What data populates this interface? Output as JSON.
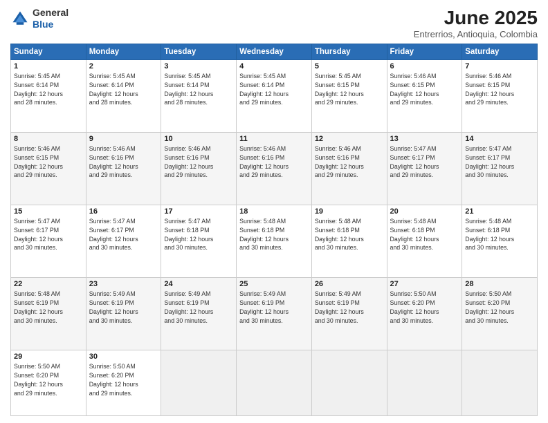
{
  "header": {
    "logo_general": "General",
    "logo_blue": "Blue",
    "month_year": "June 2025",
    "location": "Entrerrios, Antioquia, Colombia"
  },
  "weekdays": [
    "Sunday",
    "Monday",
    "Tuesday",
    "Wednesday",
    "Thursday",
    "Friday",
    "Saturday"
  ],
  "weeks": [
    [
      {
        "day": "1",
        "lines": [
          "Sunrise: 5:45 AM",
          "Sunset: 6:14 PM",
          "Daylight: 12 hours",
          "and 28 minutes."
        ]
      },
      {
        "day": "2",
        "lines": [
          "Sunrise: 5:45 AM",
          "Sunset: 6:14 PM",
          "Daylight: 12 hours",
          "and 28 minutes."
        ]
      },
      {
        "day": "3",
        "lines": [
          "Sunrise: 5:45 AM",
          "Sunset: 6:14 PM",
          "Daylight: 12 hours",
          "and 28 minutes."
        ]
      },
      {
        "day": "4",
        "lines": [
          "Sunrise: 5:45 AM",
          "Sunset: 6:14 PM",
          "Daylight: 12 hours",
          "and 29 minutes."
        ]
      },
      {
        "day": "5",
        "lines": [
          "Sunrise: 5:45 AM",
          "Sunset: 6:15 PM",
          "Daylight: 12 hours",
          "and 29 minutes."
        ]
      },
      {
        "day": "6",
        "lines": [
          "Sunrise: 5:46 AM",
          "Sunset: 6:15 PM",
          "Daylight: 12 hours",
          "and 29 minutes."
        ]
      },
      {
        "day": "7",
        "lines": [
          "Sunrise: 5:46 AM",
          "Sunset: 6:15 PM",
          "Daylight: 12 hours",
          "and 29 minutes."
        ]
      }
    ],
    [
      {
        "day": "8",
        "lines": [
          "Sunrise: 5:46 AM",
          "Sunset: 6:15 PM",
          "Daylight: 12 hours",
          "and 29 minutes."
        ]
      },
      {
        "day": "9",
        "lines": [
          "Sunrise: 5:46 AM",
          "Sunset: 6:16 PM",
          "Daylight: 12 hours",
          "and 29 minutes."
        ]
      },
      {
        "day": "10",
        "lines": [
          "Sunrise: 5:46 AM",
          "Sunset: 6:16 PM",
          "Daylight: 12 hours",
          "and 29 minutes."
        ]
      },
      {
        "day": "11",
        "lines": [
          "Sunrise: 5:46 AM",
          "Sunset: 6:16 PM",
          "Daylight: 12 hours",
          "and 29 minutes."
        ]
      },
      {
        "day": "12",
        "lines": [
          "Sunrise: 5:46 AM",
          "Sunset: 6:16 PM",
          "Daylight: 12 hours",
          "and 29 minutes."
        ]
      },
      {
        "day": "13",
        "lines": [
          "Sunrise: 5:47 AM",
          "Sunset: 6:17 PM",
          "Daylight: 12 hours",
          "and 29 minutes."
        ]
      },
      {
        "day": "14",
        "lines": [
          "Sunrise: 5:47 AM",
          "Sunset: 6:17 PM",
          "Daylight: 12 hours",
          "and 30 minutes."
        ]
      }
    ],
    [
      {
        "day": "15",
        "lines": [
          "Sunrise: 5:47 AM",
          "Sunset: 6:17 PM",
          "Daylight: 12 hours",
          "and 30 minutes."
        ]
      },
      {
        "day": "16",
        "lines": [
          "Sunrise: 5:47 AM",
          "Sunset: 6:17 PM",
          "Daylight: 12 hours",
          "and 30 minutes."
        ]
      },
      {
        "day": "17",
        "lines": [
          "Sunrise: 5:47 AM",
          "Sunset: 6:18 PM",
          "Daylight: 12 hours",
          "and 30 minutes."
        ]
      },
      {
        "day": "18",
        "lines": [
          "Sunrise: 5:48 AM",
          "Sunset: 6:18 PM",
          "Daylight: 12 hours",
          "and 30 minutes."
        ]
      },
      {
        "day": "19",
        "lines": [
          "Sunrise: 5:48 AM",
          "Sunset: 6:18 PM",
          "Daylight: 12 hours",
          "and 30 minutes."
        ]
      },
      {
        "day": "20",
        "lines": [
          "Sunrise: 5:48 AM",
          "Sunset: 6:18 PM",
          "Daylight: 12 hours",
          "and 30 minutes."
        ]
      },
      {
        "day": "21",
        "lines": [
          "Sunrise: 5:48 AM",
          "Sunset: 6:18 PM",
          "Daylight: 12 hours",
          "and 30 minutes."
        ]
      }
    ],
    [
      {
        "day": "22",
        "lines": [
          "Sunrise: 5:48 AM",
          "Sunset: 6:19 PM",
          "Daylight: 12 hours",
          "and 30 minutes."
        ]
      },
      {
        "day": "23",
        "lines": [
          "Sunrise: 5:49 AM",
          "Sunset: 6:19 PM",
          "Daylight: 12 hours",
          "and 30 minutes."
        ]
      },
      {
        "day": "24",
        "lines": [
          "Sunrise: 5:49 AM",
          "Sunset: 6:19 PM",
          "Daylight: 12 hours",
          "and 30 minutes."
        ]
      },
      {
        "day": "25",
        "lines": [
          "Sunrise: 5:49 AM",
          "Sunset: 6:19 PM",
          "Daylight: 12 hours",
          "and 30 minutes."
        ]
      },
      {
        "day": "26",
        "lines": [
          "Sunrise: 5:49 AM",
          "Sunset: 6:19 PM",
          "Daylight: 12 hours",
          "and 30 minutes."
        ]
      },
      {
        "day": "27",
        "lines": [
          "Sunrise: 5:50 AM",
          "Sunset: 6:20 PM",
          "Daylight: 12 hours",
          "and 30 minutes."
        ]
      },
      {
        "day": "28",
        "lines": [
          "Sunrise: 5:50 AM",
          "Sunset: 6:20 PM",
          "Daylight: 12 hours",
          "and 30 minutes."
        ]
      }
    ],
    [
      {
        "day": "29",
        "lines": [
          "Sunrise: 5:50 AM",
          "Sunset: 6:20 PM",
          "Daylight: 12 hours",
          "and 29 minutes."
        ]
      },
      {
        "day": "30",
        "lines": [
          "Sunrise: 5:50 AM",
          "Sunset: 6:20 PM",
          "Daylight: 12 hours",
          "and 29 minutes."
        ]
      },
      {
        "day": "",
        "lines": []
      },
      {
        "day": "",
        "lines": []
      },
      {
        "day": "",
        "lines": []
      },
      {
        "day": "",
        "lines": []
      },
      {
        "day": "",
        "lines": []
      }
    ]
  ]
}
